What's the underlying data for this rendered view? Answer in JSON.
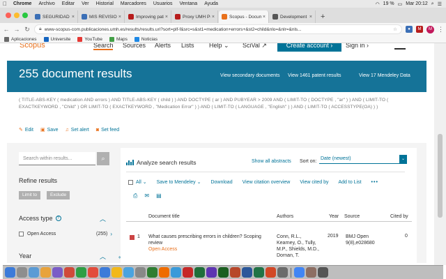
{
  "menubar": {
    "apple": "",
    "items": [
      "Chrome",
      "Archivo",
      "Editar",
      "Ver",
      "Historial",
      "Marcadores",
      "Usuarios",
      "Ventana",
      "Ayuda"
    ],
    "battery": "19 %",
    "clock": "Mar 20:12"
  },
  "tabs": [
    {
      "label": "SEGURIDAD PEDIÁ",
      "color": "#3b6fb6"
    },
    {
      "label": "MIS REVISIONES",
      "color": "#3b6fb6"
    },
    {
      "label": "Improving patients",
      "color": "#b71c1c"
    },
    {
      "label": "Proxy UMH Publicac",
      "color": "#b71c1c"
    },
    {
      "label": "Scopus - Docume",
      "color": "#e9711c",
      "active": true
    },
    {
      "label": "Development and t",
      "color": "#555555"
    }
  ],
  "newtab": "+",
  "addressbar": {
    "url": "www-scopus-com.publicaciones.umh.es/results/results.uri?sort=plf-f&src=s&st1=medication+errors+&st2=child&nlo=&nlr=&nls...",
    "avatar": "M"
  },
  "bookmarks": [
    {
      "label": "Aplicaciones",
      "color": "#6a6a6a"
    },
    {
      "label": "Universite",
      "color": "#1565c0"
    },
    {
      "label": "YouTube",
      "color": "#e53935"
    },
    {
      "label": "Maps",
      "color": "#43a047"
    },
    {
      "label": "Noticias",
      "color": "#1e88e5"
    }
  ],
  "scopus_nav": {
    "logo": "Scopus",
    "items": [
      "Search",
      "Sources",
      "Alerts",
      "Lists",
      "Help ⌄",
      "SciVal ↗"
    ],
    "create_account": "Create account ›",
    "sign_in": "Sign in ›"
  },
  "banner": {
    "title": "255 document results",
    "links": [
      "View secondary documents",
      "View 1461 patent results",
      "View 17 Mendeley Data"
    ]
  },
  "query": "( TITLE-ABS-KEY ( medication  AND errors ) AND  TITLE-ABS-KEY ( child ) )  AND  DOCTYPE ( ar )  AND  PUBYEAR  >  2009  AND  ( LIMIT-TO ( DOCTYPE ,  \"ar\" ) )  AND  ( LIMIT-TO ( EXACTKEYWORD ,  \"Child\" )  OR  LIMIT-TO ( EXACTKEYWORD ,  \"Medication Error\" ) )  AND  ( LIMIT-TO ( LANGUAGE ,  \"English\" ) )  AND  ( LIMIT-TO ( ACCESSTYPE(OA) ) )",
  "query_actions": [
    "Edit",
    "Save",
    "Set alert",
    "Set feed"
  ],
  "sidebar": {
    "search_placeholder": "Search within results...",
    "refine": "Refine results",
    "limit_to": "Limit to",
    "exclude": "Exclude",
    "access_type": "Access type",
    "help": "?",
    "open_access": "Open Access",
    "open_access_count": "(255)",
    "year": "Year"
  },
  "panel": {
    "analyze": "Analyze search results",
    "show_all": "Show all abstracts",
    "sort_on": "Sort on:",
    "sort_value": "Date (newest)",
    "tools": [
      "All ⌄",
      "Save to Mendeley ⌄",
      "Download",
      "View citation overview",
      "View cited by",
      "Add to List",
      "•••"
    ],
    "headers": [
      "Document title",
      "Authors",
      "Year",
      "Source",
      "Cited by"
    ],
    "rows": [
      {
        "num": "1",
        "title": "What causes prescribing errors in children? Scoping review",
        "access": "Open Access",
        "authors": "Conn, R.L., Kearney, O., Tully, M.P., Shields, M.D., Dornan, T.",
        "year": "2019",
        "source": "BMJ Open 9(8),e028680",
        "cited": "0"
      }
    ]
  },
  "dock_colors": [
    "#3d7bd9",
    "#8e8e8e",
    "#5b9bd5",
    "#e8a33c",
    "#7a5cc7",
    "#d04a3a",
    "#2f9e44",
    "#e24c3c",
    "#3d7bd9",
    "#f2b81a",
    "#4aa3df",
    "#888",
    "#2e7d32",
    "#ef6c00",
    "#3a9ad9",
    "#c62828",
    "#1f6f3a",
    "#5e35b1",
    "#1b5e20",
    "#b7472a",
    "#2b579a",
    "#217346",
    "#d24726",
    "#6b6b6b",
    "#4285f4",
    "#8d6e63",
    "#555"
  ]
}
